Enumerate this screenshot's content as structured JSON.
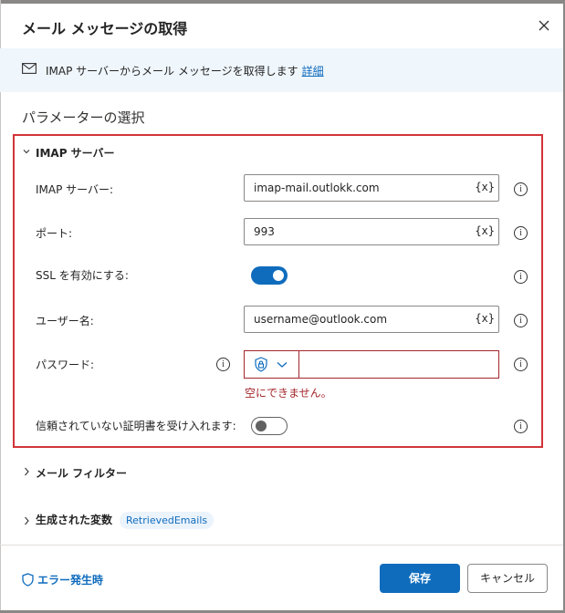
{
  "dialog": {
    "title": "メール メッセージの取得"
  },
  "banner": {
    "text": "IMAP サーバーからメール メッセージを取得します",
    "link": "詳細"
  },
  "section_title": "パラメーターの選択",
  "imap_group": {
    "header": "IMAP サーバー",
    "server": {
      "label": "IMAP サーバー:",
      "value": "imap-mail.outlokk.com",
      "var_btn": "{x}"
    },
    "port": {
      "label": "ポート:",
      "value": "993",
      "var_btn": "{x}"
    },
    "ssl": {
      "label": "SSL を有効にする:",
      "enabled": true
    },
    "username": {
      "label": "ユーザー名:",
      "value": "username@outlook.com",
      "var_btn": "{x}"
    },
    "password": {
      "label": "パスワード:",
      "value": "",
      "error": "空にできません。"
    },
    "untrusted_cert": {
      "label": "信頼されていない証明書を受け入れます:",
      "enabled": false
    }
  },
  "mail_filter": {
    "header": "メール フィルター"
  },
  "generated_vars": {
    "header": "生成された変数",
    "chip": "RetrievedEmails"
  },
  "footer": {
    "on_error": "エラー発生時",
    "save": "保存",
    "cancel": "キャンセル"
  },
  "colors": {
    "accent": "#0f6cbd",
    "error": "#a4262c",
    "highlight_box": "#d13438"
  }
}
